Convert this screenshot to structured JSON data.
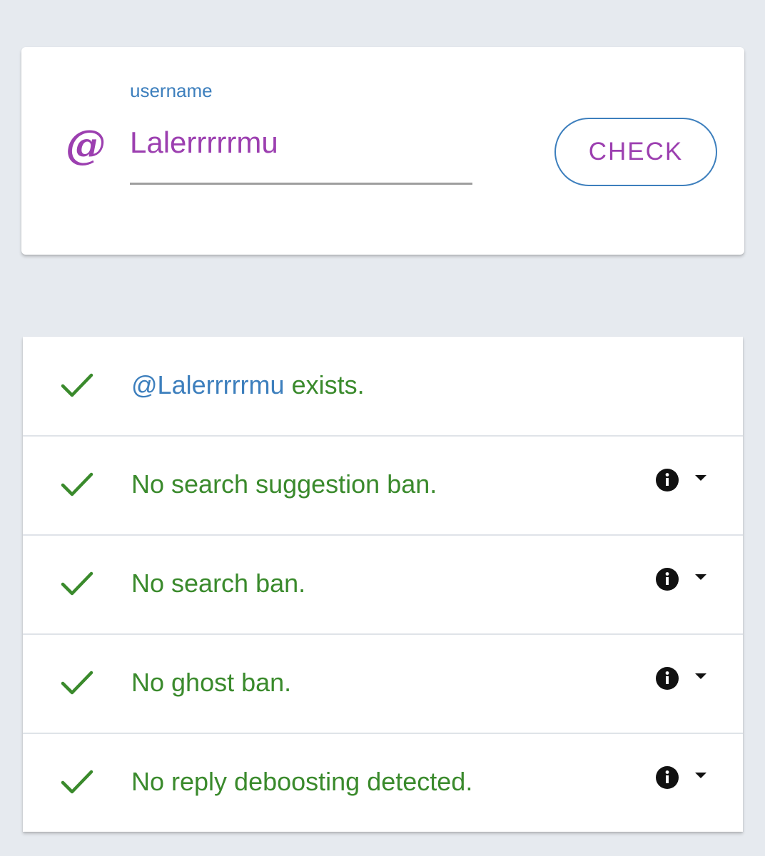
{
  "search": {
    "at_symbol": "@",
    "label": "username",
    "value": "Lalerrrrrmu",
    "button_label": "CHECK"
  },
  "results": [
    {
      "handle": "@Lalerrrrrmu",
      "text": " exists.",
      "has_info": false,
      "icon": "checkmark-icon"
    },
    {
      "text": "No search suggestion ban.",
      "has_info": true,
      "icon": "checkmark-icon"
    },
    {
      "text": "No search ban.",
      "has_info": true,
      "icon": "checkmark-icon"
    },
    {
      "text": "No ghost ban.",
      "has_info": true,
      "icon": "checkmark-icon"
    },
    {
      "text": "No reply deboosting detected.",
      "has_info": true,
      "icon": "checkmark-icon"
    }
  ],
  "colors": {
    "accent_purple": "#9c3fb0",
    "accent_blue": "#3d7fbd",
    "success_green": "#3a8a2c",
    "background": "#e6eaef"
  }
}
